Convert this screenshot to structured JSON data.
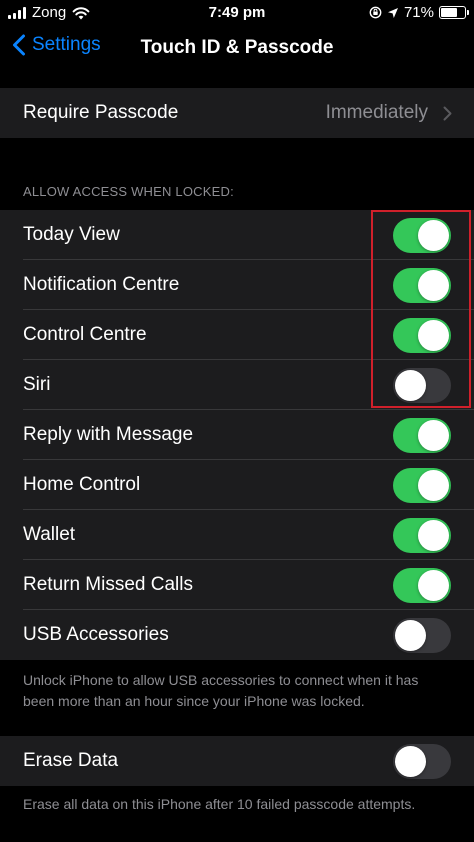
{
  "status_bar": {
    "carrier": "Zong",
    "time": "7:49 pm",
    "battery_text": "71%",
    "battery_level": 0.71
  },
  "nav": {
    "back_label": "Settings",
    "title": "Touch ID & Passcode"
  },
  "require_passcode": {
    "label": "Require Passcode",
    "value": "Immediately"
  },
  "locked_section": {
    "header": "ALLOW ACCESS WHEN LOCKED:",
    "items": [
      {
        "label": "Today View",
        "on": true
      },
      {
        "label": "Notification Centre",
        "on": true
      },
      {
        "label": "Control Centre",
        "on": true
      },
      {
        "label": "Siri",
        "on": false
      },
      {
        "label": "Reply with Message",
        "on": true
      },
      {
        "label": "Home Control",
        "on": true
      },
      {
        "label": "Wallet",
        "on": true
      },
      {
        "label": "Return Missed Calls",
        "on": true
      },
      {
        "label": "USB Accessories",
        "on": false
      }
    ],
    "footer": "Unlock iPhone to allow USB accessories to connect when it has been more than an hour since your iPhone was locked."
  },
  "erase_section": {
    "label": "Erase Data",
    "on": false,
    "footer": "Erase all data on this iPhone after 10 failed passcode attempts."
  },
  "colors": {
    "accent": "#0a84ff",
    "toggle_on": "#34c759",
    "toggle_off": "#39393d",
    "cell_bg": "#1c1c1e",
    "annotation": "#d0202b"
  }
}
